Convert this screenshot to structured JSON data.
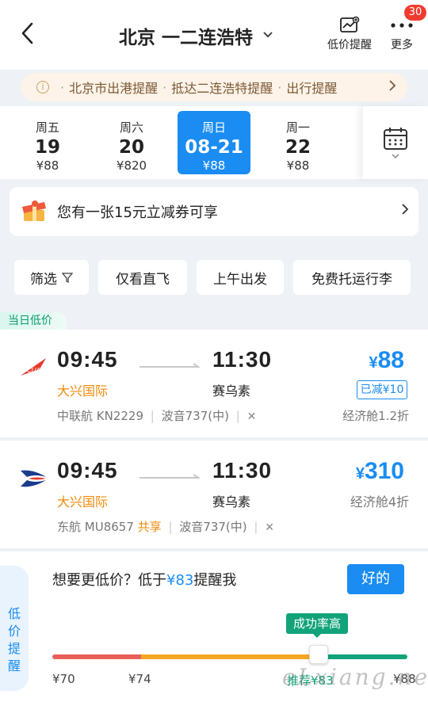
{
  "header": {
    "back_icon": "back-chevron-icon",
    "route": "北京 一二连浩特",
    "price_alert_label": "低价提醒",
    "more_label": "更多",
    "badge_count": "30"
  },
  "notice": {
    "items": [
      "北京市出港提醒",
      "抵达二连浩特提醒",
      "出行提醒"
    ],
    "separator": "·"
  },
  "dates": [
    {
      "weekday": "周五",
      "date": "19",
      "price": "¥88"
    },
    {
      "weekday": "周六",
      "date": "20",
      "price": "¥820"
    },
    {
      "weekday": "周日",
      "date": "08-21",
      "price": "¥88",
      "selected": true
    },
    {
      "weekday": "周一",
      "date": "22",
      "price": "¥88"
    }
  ],
  "coupon": {
    "text": "您有一张15元立减券可享"
  },
  "filters": {
    "filter": "筛选",
    "direct": "仅看直飞",
    "morning": "上午出发",
    "free_luggage": "免费托运行李"
  },
  "low_price_tag": "当日低价",
  "flights": [
    {
      "dep_time": "09:45",
      "arr_time": "11:30",
      "dep_airport": "大兴国际",
      "arr_airport": "赛乌素",
      "price_symbol": "¥",
      "price": "88",
      "discount_badge": "已减¥10",
      "airline": "中联航 KN2229",
      "aircraft": "波音737(中)",
      "cabin": "经济舱1.2折",
      "brand_color": "#e63a2e"
    },
    {
      "dep_time": "09:45",
      "arr_time": "11:30",
      "dep_airport": "大兴国际",
      "arr_airport": "赛乌素",
      "price_symbol": "¥",
      "price": "310",
      "airline": "东航 MU8657",
      "shared": "共享",
      "aircraft": "波音737(中)",
      "cabin": "经济舱4折",
      "brand_color": "#1b3c8c"
    }
  ],
  "alert": {
    "side_label": "低价提醒",
    "question_prefix": "想要更低价？低于",
    "question_price": "¥83",
    "question_suffix": "提醒我",
    "ok_label": "好的",
    "tip": "成功率高",
    "ticks": [
      "¥70",
      "¥74",
      "推荐¥83",
      "¥88"
    ],
    "colors": {
      "low": "#e8605a",
      "mid": "#f5a623",
      "high": "#12a37a"
    }
  },
  "watermark": "eLxiang.net",
  "colors": {
    "accent": "#1a8cf2",
    "orange": "#f08a0a"
  }
}
